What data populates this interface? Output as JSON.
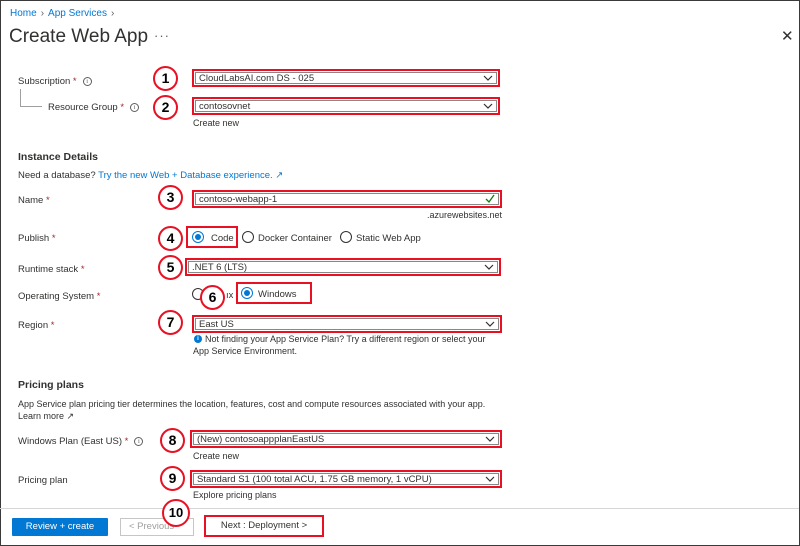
{
  "breadcrumb": {
    "home": "Home",
    "app_services": "App Services"
  },
  "page": {
    "title": "Create Web App",
    "more": "···",
    "close": "✕"
  },
  "basics": {
    "subscription_label": "Subscription",
    "subscription_value": "CloudLabsAI.com DS - 025",
    "resource_group_label": "Resource Group",
    "resource_group_value": "contosovnet",
    "create_new": "Create new"
  },
  "instance": {
    "heading": "Instance Details",
    "db_prompt": "Need a database?",
    "db_link": "Try the new Web + Database experience. ↗",
    "name_label": "Name",
    "name_value": "contoso-webapp-1",
    "domain_suffix": ".azurewebsites.net",
    "publish_label": "Publish",
    "publish_options": [
      "Code",
      "Docker Container",
      "Static Web App"
    ],
    "runtime_label": "Runtime stack",
    "runtime_value": ".NET 6 (LTS)",
    "os_label": "Operating System",
    "os_linux_partial": "ıx",
    "os_windows": "Windows",
    "region_label": "Region",
    "region_value": "East US",
    "region_hint_1": "Not finding your App Service Plan? Try a different region or select your",
    "region_hint_2": "App Service Environment."
  },
  "pricing": {
    "heading": "Pricing plans",
    "description": "App Service plan pricing tier determines the location, features, cost and compute resources associated with your app.",
    "learn_more": "Learn more ↗",
    "plan_label": "Windows Plan (East US)",
    "plan_value": "(New) contosoappplanEastUS",
    "create_new": "Create new",
    "pricing_label": "Pricing plan",
    "pricing_value": "Standard S1 (100 total ACU, 1.75 GB memory, 1 vCPU)",
    "explore": "Explore pricing plans"
  },
  "footer": {
    "review_create": "Review + create",
    "previous": "< Previous",
    "next": "Next : Deployment >"
  },
  "badges": [
    "1",
    "2",
    "3",
    "4",
    "5",
    "6",
    "7",
    "8",
    "9",
    "10"
  ],
  "colors": {
    "accent": "#0078d4",
    "highlight": "#e81123",
    "required": "#a4262c",
    "valid": "#107c10"
  }
}
